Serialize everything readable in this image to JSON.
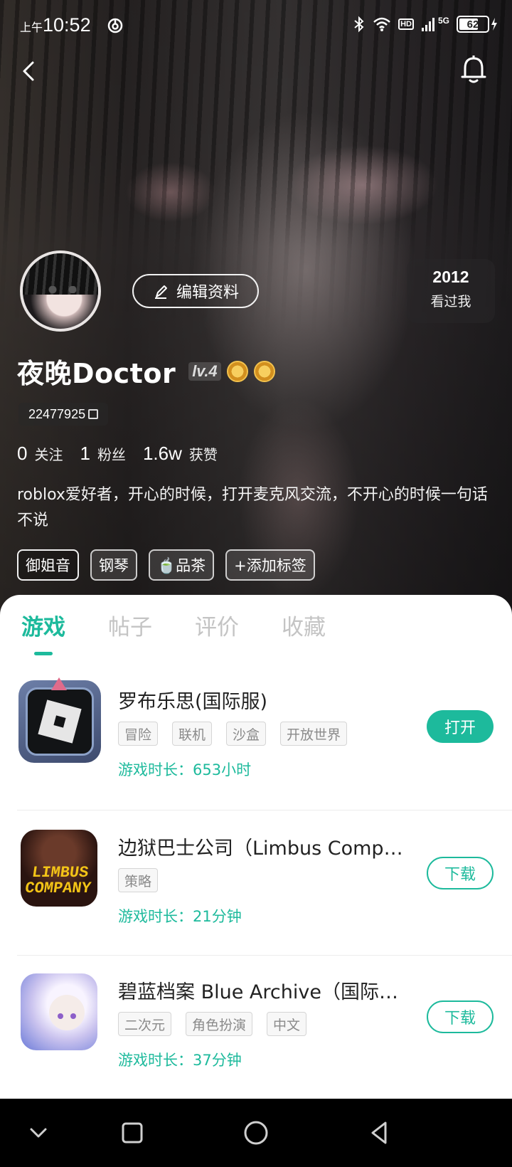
{
  "status_bar": {
    "period": "上午",
    "time": "10:52",
    "network": "5G",
    "hd": "HD",
    "battery": "62",
    "icons": [
      "bluetooth-icon",
      "wifi-icon",
      "signal-icon",
      "charging-icon"
    ]
  },
  "nav": {
    "back_icon": "chevron-left-icon",
    "bell_icon": "bell-icon"
  },
  "profile": {
    "edit_label": "编辑资料",
    "visited_count": "2012",
    "visited_label": "看过我",
    "username": "夜晚Doctor",
    "level": "lv.4",
    "uid": "22477925",
    "stats": [
      {
        "value": "0",
        "label": "关注"
      },
      {
        "value": "1",
        "label": "粉丝"
      },
      {
        "value": "1.6w",
        "label": "获赞"
      }
    ],
    "bio": "roblox爱好者，开心的时候，打开麦克风交流，不开心的时候一句话不说",
    "tags": [
      "御姐音",
      "钢琴",
      "🍵品茶",
      "+添加标签"
    ]
  },
  "tabs": [
    "游戏",
    "帖子",
    "评价",
    "收藏"
  ],
  "games": [
    {
      "title": "罗布乐思(国际服)",
      "tags": [
        "冒险",
        "联机",
        "沙盒",
        "开放世界"
      ],
      "playtime": "游戏时长：653小时",
      "action": "打开"
    },
    {
      "title": "边狱巴士公司（Limbus Company）",
      "tags": [
        "策略"
      ],
      "playtime": "游戏时长：21分钟",
      "action": "下载",
      "icon_text": "LIMBUS COMPANY"
    },
    {
      "title": "碧蓝档案 Blue Archive（国际服）",
      "tags": [
        "二次元",
        "角色扮演",
        "中文"
      ],
      "playtime": "游戏时长：37分钟",
      "action": "下载"
    }
  ],
  "colors": {
    "accent": "#1dba9c",
    "tag_border": "#d5d5d5",
    "tab_inactive": "#c4c4c4"
  }
}
